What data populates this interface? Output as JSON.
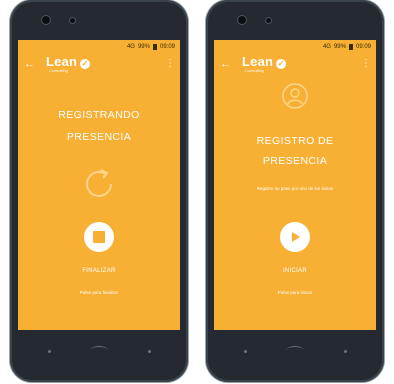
{
  "status_bar": {
    "time": "09:09",
    "battery": "99%",
    "signal": "4G"
  },
  "screens": [
    {
      "logo": "Lean",
      "logo_sub": "Consulting",
      "title_line1": "REGISTRANDO",
      "title_line2": "PRESENCIA",
      "action_label": "FINALIZAR",
      "hint": "Pulse para finalizar"
    },
    {
      "logo": "Lean",
      "logo_sub": "Consulting",
      "title_line1": "REGISTRO DE",
      "title_line2": "PRESENCIA",
      "description": "Registre su paso por uno de los éxitos",
      "action_label": "INICIAR",
      "hint": "Pulse para iniciar"
    }
  ],
  "icons": {
    "back": "arrow-left-icon",
    "menu": "more-vert-icon",
    "check": "check-circle-icon",
    "refresh": "refresh-icon",
    "stop": "stop-icon",
    "play": "play-icon",
    "user": "user-badge-icon"
  },
  "colors": {
    "accent": "#f7b034",
    "bezel": "#242a30",
    "text": "#ffffff"
  }
}
